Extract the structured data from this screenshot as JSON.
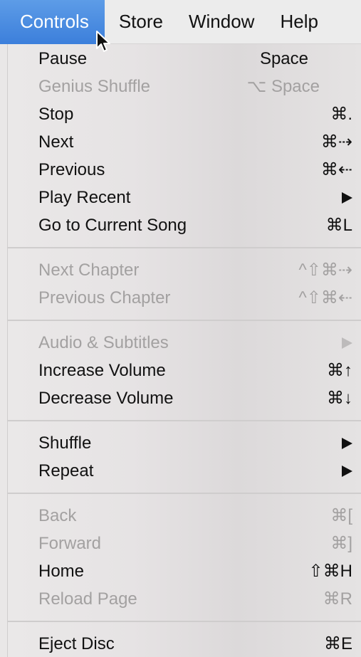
{
  "menubar": {
    "items": [
      "Controls",
      "Store",
      "Window",
      "Help"
    ]
  },
  "menu": {
    "groups": [
      [
        {
          "label": "Pause",
          "shortcut": "Space",
          "enabled": true
        },
        {
          "label": "Genius Shuffle",
          "shortcut": "⌥ Space",
          "enabled": false
        },
        {
          "label": "Stop",
          "shortcut": "⌘.",
          "enabled": true
        },
        {
          "label": "Next",
          "shortcut": "⌘⇢",
          "enabled": true
        },
        {
          "label": "Previous",
          "shortcut": "⌘⇠",
          "enabled": true
        },
        {
          "label": "Play Recent",
          "submenu": true,
          "enabled": true
        },
        {
          "label": "Go to Current Song",
          "shortcut": "⌘L",
          "enabled": true
        }
      ],
      [
        {
          "label": "Next Chapter",
          "shortcut": "^⇧⌘⇢",
          "enabled": false
        },
        {
          "label": "Previous Chapter",
          "shortcut": "^⇧⌘⇠",
          "enabled": false
        }
      ],
      [
        {
          "label": "Audio & Subtitles",
          "submenu": true,
          "enabled": false
        },
        {
          "label": "Increase Volume",
          "shortcut": "⌘↑",
          "enabled": true
        },
        {
          "label": "Decrease Volume",
          "shortcut": "⌘↓",
          "enabled": true
        }
      ],
      [
        {
          "label": "Shuffle",
          "submenu": true,
          "enabled": true
        },
        {
          "label": "Repeat",
          "submenu": true,
          "enabled": true
        }
      ],
      [
        {
          "label": "Back",
          "shortcut": "⌘[",
          "enabled": false
        },
        {
          "label": "Forward",
          "shortcut": "⌘]",
          "enabled": false
        },
        {
          "label": "Home",
          "shortcut": "⇧⌘H",
          "enabled": true
        },
        {
          "label": "Reload Page",
          "shortcut": "⌘R",
          "enabled": false
        }
      ],
      [
        {
          "label": "Eject Disc",
          "shortcut": "⌘E",
          "enabled": true
        }
      ]
    ]
  }
}
